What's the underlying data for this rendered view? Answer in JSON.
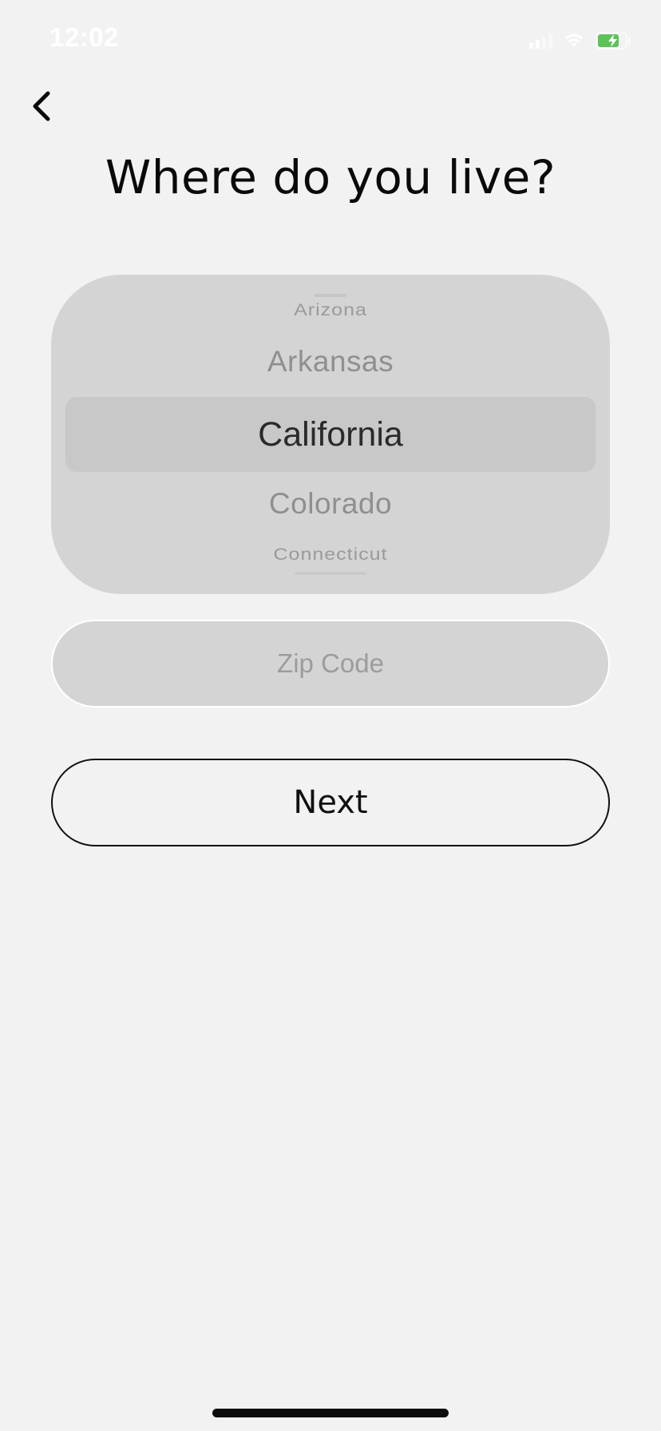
{
  "status_bar": {
    "time": "12:02",
    "signal_icon": "cellular-signal-icon",
    "wifi_icon": "wifi-icon",
    "battery_icon": "battery-charging-icon",
    "battery_color": "#5ec25a"
  },
  "nav": {
    "back_icon": "chevron-left-icon"
  },
  "title": "Where do you live?",
  "state_picker": {
    "items": [
      "Arizona",
      "Arkansas",
      "California",
      "Colorado",
      "Connecticut"
    ],
    "selected": "California"
  },
  "zip": {
    "placeholder": "Zip Code",
    "value": ""
  },
  "next_button": {
    "label": "Next"
  },
  "colors": {
    "background": "#f2f2f2",
    "picker_bg": "#d4d4d4",
    "text_primary": "#0a0a0a"
  }
}
